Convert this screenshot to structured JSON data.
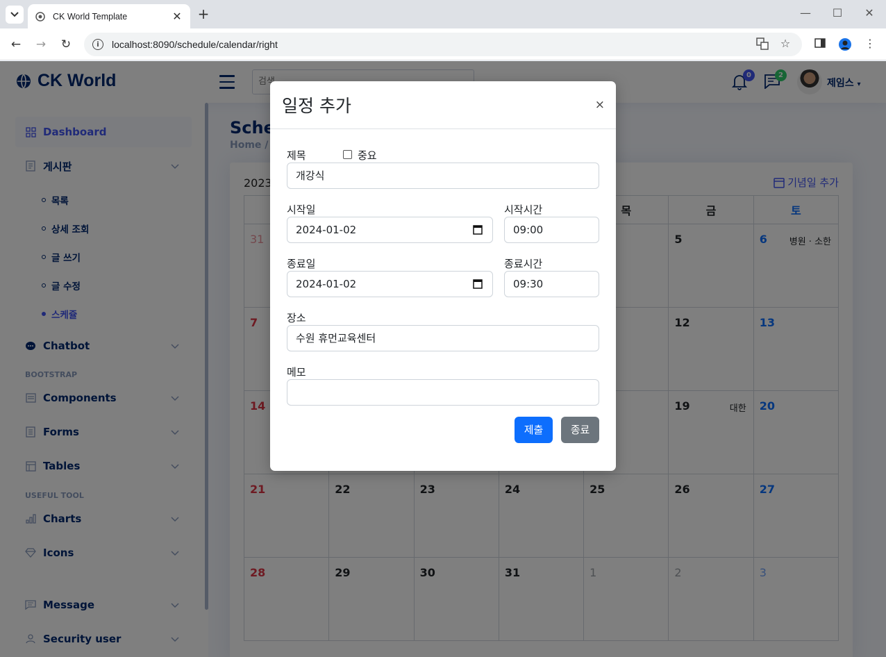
{
  "browser": {
    "tab_title": "CK World Template",
    "url": "localhost:8090/schedule/calendar/right"
  },
  "header": {
    "logo_text": "CK World",
    "search_placeholder": "검색",
    "notifications_count": "0",
    "messages_count": "2",
    "user_name": "제임스"
  },
  "sidebar": {
    "dashboard": "Dashboard",
    "board": "게시판",
    "board_items": [
      "목록",
      "상세 조회",
      "글 쓰기",
      "글 수정",
      "스케쥴"
    ],
    "chatbot": "Chatbot",
    "heading_bootstrap": "BOOTSTRAP",
    "components": "Components",
    "forms": "Forms",
    "tables": "Tables",
    "heading_useful": "USEFUL TOOL",
    "charts": "Charts",
    "icons": "Icons",
    "message": "Message",
    "security_user": "Security user"
  },
  "main": {
    "page_title": "Sched",
    "breadcrumb": "Home  /",
    "month_label": "2023-",
    "anniversary_button": "기념일 추가",
    "weekday_headers": [
      "",
      "",
      "",
      "",
      "목",
      "금",
      "토"
    ],
    "weeks": [
      [
        "31",
        "",
        "",
        "",
        "",
        "5",
        "6"
      ],
      [
        "7",
        "",
        "",
        "",
        "",
        "12",
        "13"
      ],
      [
        "14",
        "",
        "",
        "",
        "",
        "19",
        "20"
      ],
      [
        "21",
        "22",
        "23",
        "24",
        "25",
        "26",
        "27"
      ],
      [
        "28",
        "29",
        "30",
        "31",
        "1",
        "2",
        "3"
      ]
    ],
    "events": {
      "sat_week1": "병원 · 소한",
      "fri_week3": "대한"
    }
  },
  "modal": {
    "title": "일정 추가",
    "close": "×",
    "title_label": "제목",
    "important_label": "중요",
    "title_value": "개강식",
    "start_date_label": "시작일",
    "start_date_value": "2024-01-02",
    "start_time_label": "시작시간",
    "start_time_value": "09:00",
    "end_date_label": "종료일",
    "end_date_value": "2024-01-02",
    "end_time_label": "종료시간",
    "end_time_value": "09:30",
    "place_label": "장소",
    "place_value": "수원 휴먼교육센터",
    "memo_label": "메모",
    "memo_value": "",
    "submit_button": "제출",
    "close_button": "종료"
  },
  "colors": {
    "primary": "#4154f1",
    "navy": "#012970",
    "submit": "#0d6efd",
    "secondary": "#6c757d"
  }
}
